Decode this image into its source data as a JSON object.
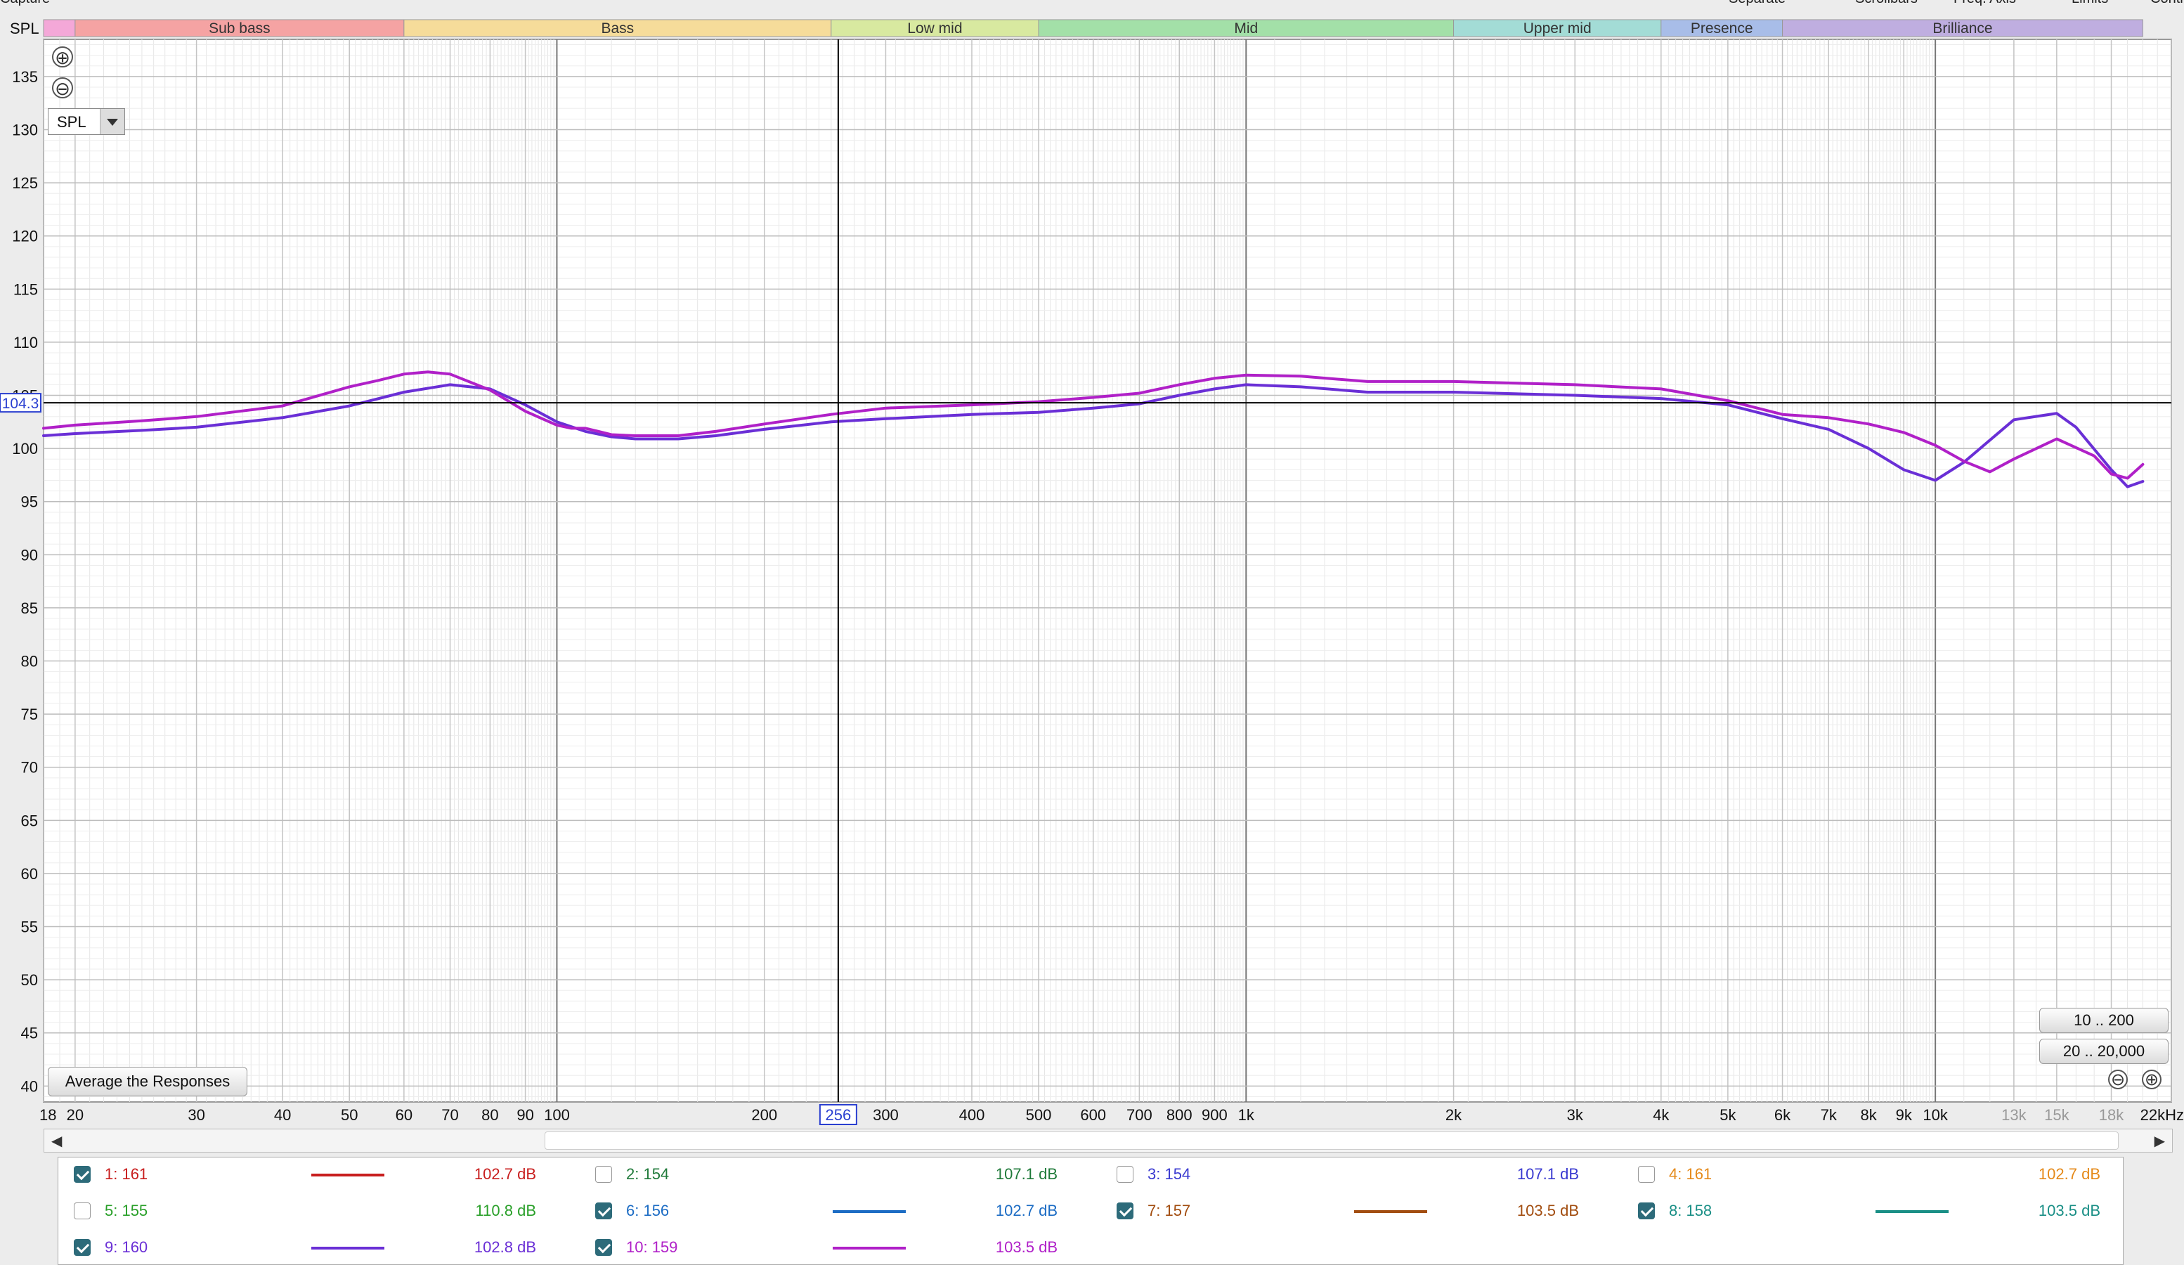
{
  "header": {
    "top_left": "Capture",
    "top_right": [
      "Separate",
      "Scrollbars",
      "Freq. Axis",
      "Limits",
      "Controls"
    ]
  },
  "chart_data": {
    "type": "line",
    "ylabel": "SPL",
    "xscale": "log",
    "xlim": [
      18,
      22000
    ],
    "ylim": [
      40,
      135
    ],
    "grid": true,
    "y_ticks": [
      "135",
      "130",
      "125",
      "120",
      "115",
      "110",
      "105",
      "100",
      "95",
      "90",
      "85",
      "80",
      "75",
      "70",
      "65",
      "60",
      "55",
      "50",
      "45",
      "40"
    ],
    "x_ticks": [
      {
        "f": 18,
        "label": "18"
      },
      {
        "f": 20,
        "label": "20"
      },
      {
        "f": 30,
        "label": "30"
      },
      {
        "f": 40,
        "label": "40"
      },
      {
        "f": 50,
        "label": "50"
      },
      {
        "f": 60,
        "label": "60"
      },
      {
        "f": 70,
        "label": "70"
      },
      {
        "f": 80,
        "label": "80"
      },
      {
        "f": 90,
        "label": "90"
      },
      {
        "f": 100,
        "label": "100"
      },
      {
        "f": 200,
        "label": "200"
      },
      {
        "f": 300,
        "label": "300"
      },
      {
        "f": 400,
        "label": "400"
      },
      {
        "f": 500,
        "label": "500"
      },
      {
        "f": 600,
        "label": "600"
      },
      {
        "f": 700,
        "label": "700"
      },
      {
        "f": 800,
        "label": "800"
      },
      {
        "f": 900,
        "label": "900"
      },
      {
        "f": 1000,
        "label": "1k"
      },
      {
        "f": 2000,
        "label": "2k"
      },
      {
        "f": 3000,
        "label": "3k"
      },
      {
        "f": 4000,
        "label": "4k"
      },
      {
        "f": 5000,
        "label": "5k"
      },
      {
        "f": 6000,
        "label": "6k"
      },
      {
        "f": 7000,
        "label": "7k"
      },
      {
        "f": 8000,
        "label": "8k"
      },
      {
        "f": 9000,
        "label": "9k"
      },
      {
        "f": 10000,
        "label": "10k"
      },
      {
        "f": 13000,
        "label": "13k",
        "dim": true
      },
      {
        "f": 15000,
        "label": "15k",
        "dim": true
      },
      {
        "f": 18000,
        "label": "18k",
        "dim": true
      },
      {
        "f": 22000,
        "label": "22kHz"
      }
    ],
    "bands": [
      {
        "name": "",
        "from": 18,
        "to": 20,
        "color": "#f4a8d8"
      },
      {
        "name": "Sub bass",
        "from": 20,
        "to": 60,
        "color": "#f5a3a3"
      },
      {
        "name": "Bass",
        "from": 60,
        "to": 250,
        "color": "#f6dc9a"
      },
      {
        "name": "Low mid",
        "from": 250,
        "to": 500,
        "color": "#d8e9a0"
      },
      {
        "name": "Mid",
        "from": 500,
        "to": 2000,
        "color": "#a3e0a8"
      },
      {
        "name": "Upper mid",
        "from": 2000,
        "to": 4000,
        "color": "#a3dcd6"
      },
      {
        "name": "Presence",
        "from": 4000,
        "to": 6000,
        "color": "#a8bde8"
      },
      {
        "name": "Brilliance",
        "from": 6000,
        "to": 20000,
        "color": "#bfaee0"
      }
    ],
    "cursor": {
      "freq": 256,
      "freq_label": "256",
      "spl": 104.3,
      "spl_label": "104.3"
    },
    "series": [
      {
        "name": "9: 160",
        "color": "#6a2fd6",
        "x": [
          18,
          20,
          25,
          30,
          40,
          50,
          60,
          70,
          80,
          90,
          100,
          110,
          120,
          130,
          150,
          170,
          200,
          250,
          300,
          400,
          500,
          600,
          700,
          800,
          900,
          1000,
          1200,
          1500,
          2000,
          3000,
          4000,
          5000,
          6000,
          7000,
          8000,
          9000,
          10000,
          11000,
          13000,
          15000,
          16000,
          18000,
          19000,
          20000
        ],
        "y": [
          101.2,
          101.4,
          101.7,
          102.0,
          102.9,
          104.0,
          105.3,
          106.0,
          105.6,
          104.1,
          102.5,
          101.6,
          101.1,
          100.9,
          100.9,
          101.2,
          101.8,
          102.5,
          102.8,
          103.2,
          103.4,
          103.8,
          104.2,
          105.0,
          105.6,
          106.0,
          105.8,
          105.3,
          105.3,
          105.0,
          104.7,
          104.1,
          102.8,
          101.8,
          100.0,
          98.0,
          97.0,
          98.7,
          102.7,
          103.3,
          102.0,
          98.0,
          96.4,
          96.9
        ]
      },
      {
        "name": "10: 159",
        "color": "#b020c8",
        "x": [
          18,
          20,
          25,
          30,
          40,
          50,
          55,
          60,
          65,
          70,
          80,
          90,
          100,
          105,
          110,
          115,
          120,
          130,
          150,
          170,
          200,
          250,
          300,
          400,
          500,
          600,
          700,
          800,
          900,
          1000,
          1200,
          1500,
          2000,
          3000,
          4000,
          5000,
          6000,
          7000,
          8000,
          9000,
          10000,
          11000,
          12000,
          13000,
          15000,
          17000,
          18000,
          19000,
          20000
        ],
        "y": [
          101.9,
          102.2,
          102.6,
          103.0,
          104.0,
          105.8,
          106.4,
          107.0,
          107.2,
          107.0,
          105.5,
          103.5,
          102.2,
          101.9,
          101.9,
          101.6,
          101.3,
          101.2,
          101.2,
          101.6,
          102.3,
          103.2,
          103.8,
          104.1,
          104.4,
          104.8,
          105.2,
          106.0,
          106.6,
          106.9,
          106.8,
          106.3,
          106.3,
          106.0,
          105.6,
          104.5,
          103.2,
          102.9,
          102.3,
          101.5,
          100.3,
          98.8,
          97.8,
          99.0,
          100.9,
          99.3,
          97.6,
          97.2,
          98.5
        ]
      }
    ]
  },
  "controls": {
    "zoom_in_icon": "⊕",
    "zoom_out_icon": "⊖",
    "spl_selector": "SPL",
    "average_button": "Average the Responses",
    "range_10_200": "10 .. 200",
    "range_20_20000": "20 .. 20,000"
  },
  "legend": {
    "items": [
      {
        "name": "1: 161",
        "value": "102.7 dB",
        "checked": true,
        "color": "#c81e1e",
        "line": true
      },
      {
        "name": "2: 154",
        "value": "107.1 dB",
        "checked": false,
        "color": "#1f7a3a",
        "line": false
      },
      {
        "name": "3: 154",
        "value": "107.1 dB",
        "checked": false,
        "color": "#3a3ad0",
        "line": false
      },
      {
        "name": "4: 161",
        "value": "102.7 dB",
        "checked": false,
        "color": "#e58a1a",
        "line": false
      },
      {
        "name": "5: 155",
        "value": "110.8 dB",
        "checked": false,
        "color": "#2aa02a",
        "line": false
      },
      {
        "name": "6: 156",
        "value": "102.7 dB",
        "checked": true,
        "color": "#1c6cc4",
        "line": true
      },
      {
        "name": "7: 157",
        "value": "103.5 dB",
        "checked": true,
        "color": "#a24d10",
        "line": true
      },
      {
        "name": "8: 158",
        "value": "103.5 dB",
        "checked": true,
        "color": "#1a8f86",
        "line": true
      },
      {
        "name": "9: 160",
        "value": "102.8 dB",
        "checked": true,
        "color": "#6a2fd6",
        "line": true
      },
      {
        "name": "10: 159",
        "value": "103.5 dB",
        "checked": true,
        "color": "#b020c8",
        "line": true
      }
    ]
  }
}
